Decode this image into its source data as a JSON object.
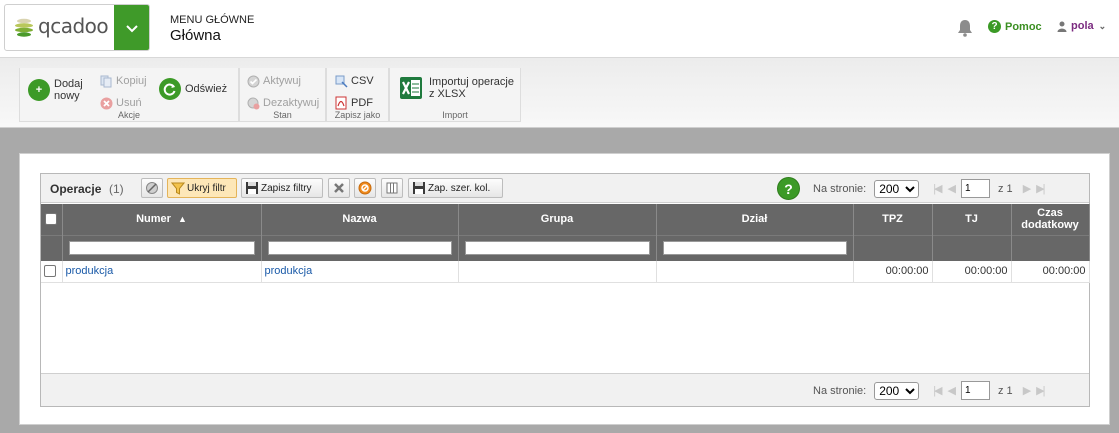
{
  "header": {
    "logo_text": "qcadoo",
    "menu_caption": "MENU GŁÓWNE",
    "menu_current": "Główna",
    "help_label": "Pomoc",
    "user_name": "pola"
  },
  "ribbon": {
    "groups": [
      {
        "label": "Akcje",
        "buttons": {
          "add": "Dodaj nowy",
          "copy": "Kopiuj",
          "delete": "Usuń",
          "refresh": "Odśwież"
        }
      },
      {
        "label": "Stan",
        "buttons": {
          "activate": "Aktywuj",
          "deactivate": "Dezaktywuj"
        }
      },
      {
        "label": "Zapisz jako",
        "buttons": {
          "csv": "CSV",
          "pdf": "PDF"
        }
      },
      {
        "label": "Import",
        "buttons": {
          "import_xlsx": "Importuj operacje z XLSX"
        }
      }
    ]
  },
  "grid": {
    "title": "Operacje",
    "count": "(1)",
    "toolbar": {
      "hide_filter": "Ukryj filtr",
      "save_filters": "Zapisz filtry",
      "save_widths": "Zap. szer. kol."
    },
    "pager": {
      "per_page_label": "Na stronie:",
      "per_page_value": "200",
      "page": "1",
      "of_label": "z 1"
    },
    "columns": [
      "Numer",
      "Nazwa",
      "Grupa",
      "Dział",
      "TPZ",
      "TJ",
      "Czas dodatkowy"
    ],
    "rows": [
      {
        "numer": "produkcja",
        "nazwa": "produkcja",
        "grupa": "",
        "dzial": "",
        "tpz": "00:00:00",
        "tj": "00:00:00",
        "czas": "00:00:00"
      }
    ]
  },
  "colors": {
    "brand_green": "#3f9a29",
    "header_gray": "#676767",
    "link_blue": "#1a5aa8",
    "user_purple": "#7b2b80"
  }
}
